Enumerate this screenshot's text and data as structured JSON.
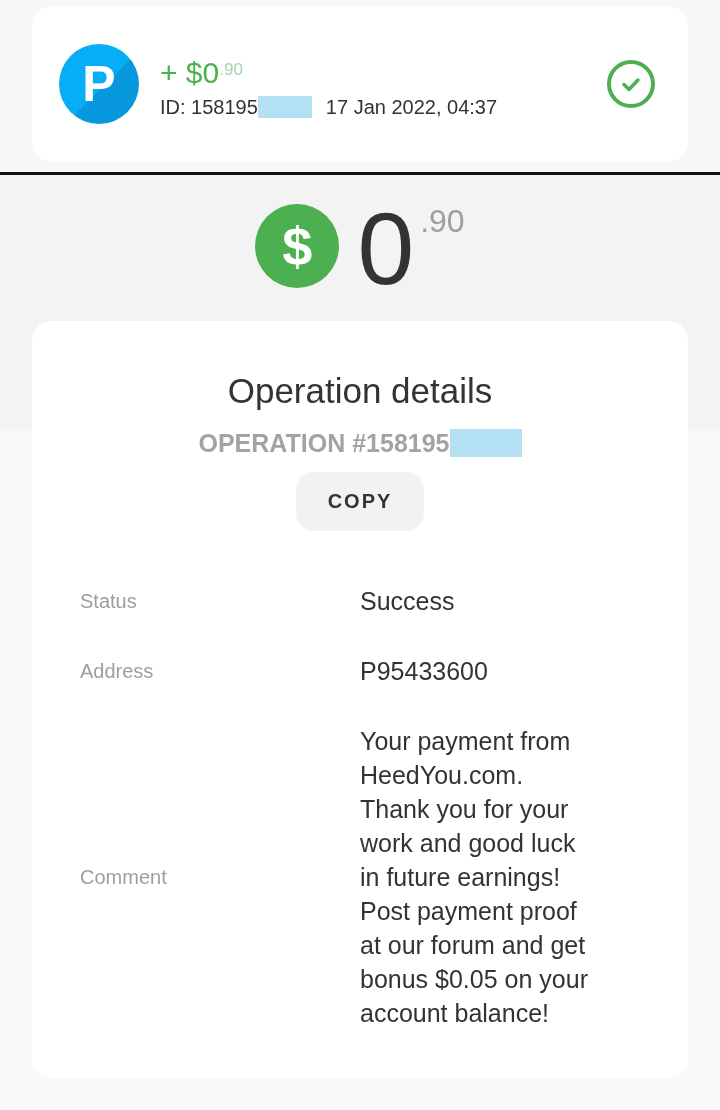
{
  "transaction": {
    "logo_letter": "P",
    "amount": "+ $0",
    "amount_cents": ".90",
    "id": "ID: 158195",
    "id_redacted": true,
    "date": "17 Jan 2022, 04:37",
    "completed": true
  },
  "balance": {
    "symbol": "$",
    "amount": "0",
    "amount_cents": ".90"
  },
  "details": {
    "title": "Operation details",
    "operation": "OPERATION #158195",
    "operation_redacted": true,
    "copy_button": "COPY",
    "rows": [
      {
        "label": "Status",
        "value": "Success"
      },
      {
        "label": "Address",
        "value": "P95433600"
      },
      {
        "label": "Comment",
        "value": "Your payment from HeedYou.com.\nThank you for your work and good luck in future earnings! Post payment proof at our forum and get bonus $0.05 on your account balance!"
      }
    ]
  }
}
